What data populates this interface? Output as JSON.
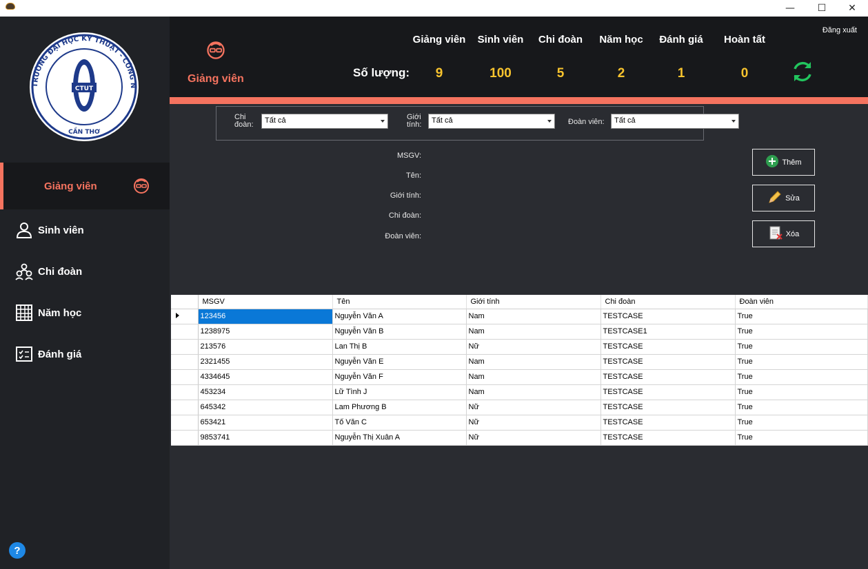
{
  "window": {
    "controls": {
      "minimize": "—",
      "maximize": "☐",
      "close": "✕"
    }
  },
  "logo": {
    "ring_text_top": "TRƯỜNG ĐẠI HỌC KỸ THUẬT - CÔNG NGHỆ",
    "ring_text_bottom": "CẦN THƠ",
    "emblem": "CTUT"
  },
  "sidebar": {
    "items": [
      {
        "label": "Giảng viên",
        "icon": "teacher-icon",
        "active": true
      },
      {
        "label": "Sinh viên",
        "icon": "student-icon",
        "active": false
      },
      {
        "label": "Chi đoàn",
        "icon": "group-icon",
        "active": false
      },
      {
        "label": "Năm học",
        "icon": "calendar-grid-icon",
        "active": false
      },
      {
        "label": "Đánh giá",
        "icon": "checklist-icon",
        "active": false
      }
    ],
    "help": "?"
  },
  "header": {
    "title": "Giảng viên",
    "logout": "Đăng xuất",
    "count_label": "Số lượng:",
    "stats": [
      {
        "label": "Giảng viên",
        "value": "9"
      },
      {
        "label": "Sinh viên",
        "value": "100"
      },
      {
        "label": "Chi đoàn",
        "value": "5"
      },
      {
        "label": "Năm học",
        "value": "2"
      },
      {
        "label": "Đánh giá",
        "value": "1"
      },
      {
        "label": "Hoàn tất",
        "value": "0"
      }
    ],
    "accent": "#f5735f",
    "value_color": "#f7c32e",
    "refresh_color": "#22c55e"
  },
  "filters": {
    "chidoan_label_1": "Chi",
    "chidoan_label_2": "đoàn:",
    "chidoan_value": "Tất cả",
    "gioitinh_label_1": "Giới",
    "gioitinh_label_2": "tính:",
    "gioitinh_value": "Tất cả",
    "doanvien_label": "Đoàn viên:",
    "doanvien_value": "Tất cả"
  },
  "form": {
    "msgv": "MSGV:",
    "ten": "Tên:",
    "gioitinh": "Giới tính:",
    "chidoan": "Chi đoàn:",
    "doanvien": "Đoàn viên:"
  },
  "actions": {
    "add": "Thêm",
    "edit": "Sửa",
    "delete": "Xóa"
  },
  "table": {
    "columns": [
      "MSGV",
      "Tên",
      "Giới tính",
      "Chi đoàn",
      "Đoàn viên"
    ],
    "rows": [
      [
        "123456",
        "Nguyễn Văn A",
        "Nam",
        "TESTCASE",
        "True"
      ],
      [
        "1238975",
        "Nguyễn Văn B",
        "Nam",
        "TESTCASE1",
        "True"
      ],
      [
        "213576",
        "Lan Thị B",
        "Nữ",
        "TESTCASE",
        "True"
      ],
      [
        "2321455",
        "Nguyễn Văn E",
        "Nam",
        "TESTCASE",
        "True"
      ],
      [
        "4334645",
        "Nguyễn Văn F",
        "Nam",
        "TESTCASE",
        "True"
      ],
      [
        "453234",
        "Lữ Tình J",
        "Nam",
        "TESTCASE",
        "True"
      ],
      [
        "645342",
        "Lam Phương B",
        "Nữ",
        "TESTCASE",
        "True"
      ],
      [
        "653421",
        "Tố Văn C",
        "Nữ",
        "TESTCASE",
        "True"
      ],
      [
        "9853741",
        "Nguyễn Thị Xuân A",
        "Nữ",
        "TESTCASE",
        "True"
      ]
    ]
  }
}
